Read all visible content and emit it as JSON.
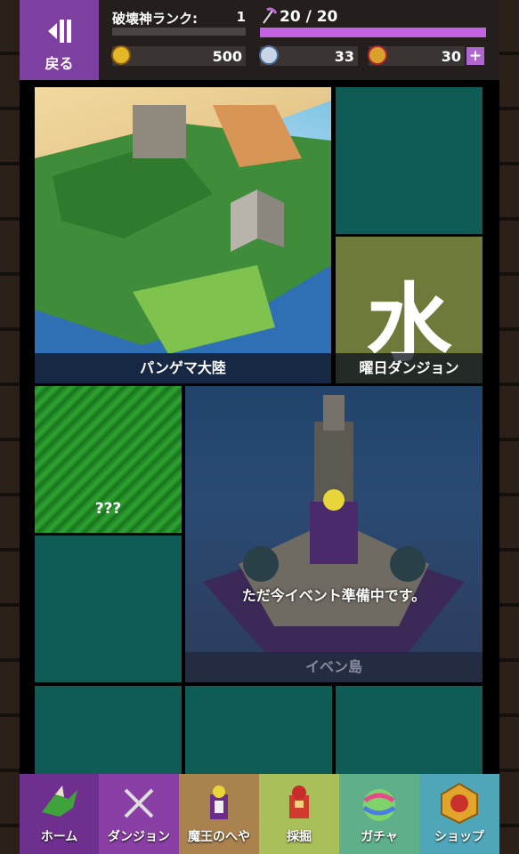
{
  "header": {
    "back_label": "戻る",
    "rank_label": "破壊神ランク:",
    "rank_value": "1",
    "stamina": "20 / 20",
    "points": "500",
    "gems": "33",
    "medals": "30",
    "plus_label": "+"
  },
  "tiles": {
    "pangea": "パンゲマ大陸",
    "youbi_kanji": "水",
    "youbi": "曜日ダンジョン",
    "unknown": "???",
    "event_notice": "ただ今イベント準備中です。",
    "event": "イベン島"
  },
  "tabs": [
    {
      "label": "ホーム",
      "color": "#6e2f8f"
    },
    {
      "label": "ダンジョン",
      "color": "#8a3fa4"
    },
    {
      "label": "魔王のへや",
      "color": "#a9824e"
    },
    {
      "label": "採掘",
      "color": "#a9bf5a"
    },
    {
      "label": "ガチャ",
      "color": "#5fb08a"
    },
    {
      "label": "ショップ",
      "color": "#4fa6b8"
    }
  ]
}
